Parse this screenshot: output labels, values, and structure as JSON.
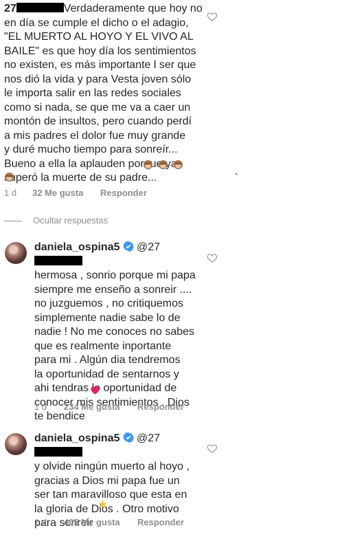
{
  "comment1": {
    "username_prefix": "27",
    "text": "Verdaderamente que hoy no\nen día se cumple el dicho o el adagio,\n\"EL MUERTO AL HOYO Y EL VIVO AL\nBAILE\" es que hoy día los sentimientos\nno existen, es más importante l ser que\nnos dió la vida y para Vesta joven sólo\nle importa salir en las redes sociales\ncomo si nada, se que me va a caer un\nmontón de insultos, pero cuando perdí\na mis padres el dolor fue muy grande\ny duré mucho tiempo para sonreír...\nBueno a ella la aplauden porque ya\nsuperó la muerte de su padre...",
    "time": "1 d",
    "likes": "32 Me gusta",
    "reply": "Responder"
  },
  "hide_replies": "Ocultar respuestas",
  "replies": [
    {
      "username": "daniela_ospina5",
      "mention_prefix": "@27",
      "text": "hermosa , sonrio porque mi papa\nsiempre me enseño a sonreir ....\nno juzguemos , no critiquemos\nsimplemente nadie sabe lo de\nnadie ! No me conoces no sabes\nque es realmente inportante\npara mi . Algún dia tendremos\nla oportunidad de sentarnos y\nahi tendras lo oportunidad de\nconocer mis sentimientos . Dios\nte bendice",
      "time": "1 d",
      "likes": "234 Me gusta",
      "reply": "Responder"
    },
    {
      "username": "daniela_ospina5",
      "mention_prefix": "@27",
      "text": "y olvide ningún muerto al hoyo ,\ngracias a Dios mi papa fue un\nser tan maravilloso que esta en\nla gloria de Dios . Otro motivo\npara sonreir",
      "time": "1 d",
      "likes": "405 Me gusta",
      "reply": "Responder"
    }
  ],
  "colors": {
    "text": "#262626",
    "muted": "#8e8e8e",
    "verified": "#3897f0",
    "heart_emoji": "#e0245e"
  },
  "icons": [
    "heart-outline-icon",
    "verified-badge-icon",
    "see-no-evil-monkey-emoji",
    "red-heart-emoji",
    "sparkle-star-emoji"
  ]
}
